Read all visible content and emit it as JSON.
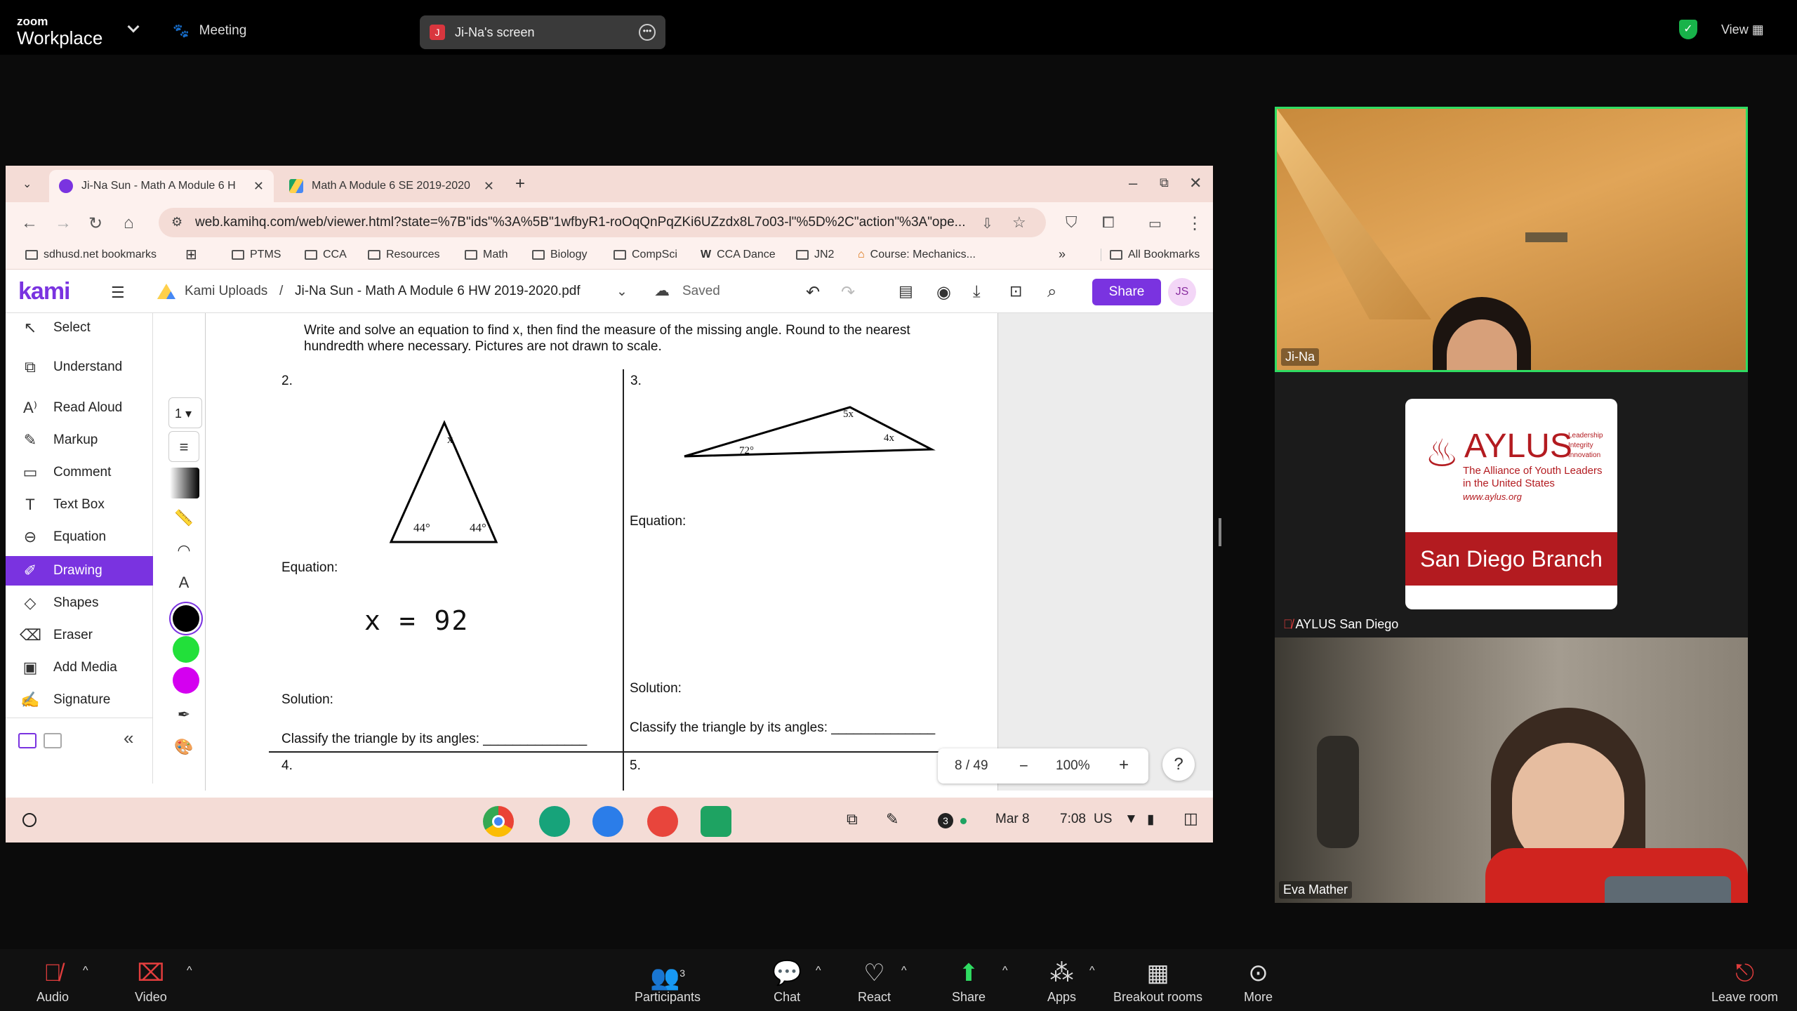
{
  "zoom": {
    "brand_small": "zoom",
    "brand_big": "Workplace",
    "meeting_label": "Meeting",
    "share_pill": {
      "initial": "J",
      "label": "Ji-Na's screen"
    },
    "view_label": "View"
  },
  "browser": {
    "tabs": [
      {
        "label": "Ji-Na Sun - Math A Module 6 H",
        "active": true
      },
      {
        "label": "Math A Module 6 SE 2019-2020",
        "active": false
      }
    ],
    "new_tab": "+",
    "url": "web.kamihq.com/web/viewer.html?state=%7B\"ids\"%3A%5B\"1wfbyR1-roOqQnPqZKi6UZzdx8L7o03-l\"%5D%2C\"action\"%3A\"ope...",
    "bookmarks": [
      "sdhusd.net bookmarks",
      "PTMS",
      "CCA",
      "Resources",
      "Math",
      "Biology",
      "CompSci",
      "CCA Dance",
      "JN2",
      "Course: Mechanics...",
      "All Bookmarks"
    ]
  },
  "kami": {
    "logo": "kami",
    "crumb_root": "Kami Uploads",
    "crumb_sep": "/",
    "doc_title": "Ji-Na Sun - Math A Module 6 HW 2019-2020.pdf",
    "saved": "Saved",
    "share": "Share",
    "avatar": "JS",
    "tools": [
      "Select",
      "Understand",
      "Read Aloud",
      "Markup",
      "Comment",
      "Text Box",
      "Equation",
      "Drawing",
      "Shapes",
      "Eraser",
      "Add Media",
      "Signature"
    ],
    "active_tool": "Drawing",
    "stroke_size": "1",
    "colors": [
      "#000000",
      "#22e03a",
      "#d400f0"
    ],
    "page_indicator": "8 / 49",
    "zoom_level": "100%",
    "help": "?"
  },
  "worksheet": {
    "instructions_line1": "Write and solve an equation to find x, then find the measure of the missing angle. Round to the nearest",
    "instructions_line2": "hundredth where necessary. Pictures are not drawn to scale.",
    "q2_num": "2.",
    "q3_num": "3.",
    "q4_num": "4.",
    "q5_num": "5.",
    "q2_angles": {
      "top": "x",
      "left": "44°",
      "right": "44°"
    },
    "q3_angles": {
      "top": "5x",
      "left": "72°",
      "right": "4x"
    },
    "equation_label": "Equation:",
    "solution_label": "Solution:",
    "classify_label": "Classify the triangle by its angles:",
    "handwriting": "x = 92"
  },
  "shelf": {
    "notification_count": "3",
    "date": "Mar 8",
    "time": "7:08",
    "locale": "US"
  },
  "participants": [
    {
      "name": "Ji-Na"
    },
    {
      "name": "AYLUS San Diego"
    },
    {
      "name": "Eva Mather"
    }
  ],
  "aylus_logo": {
    "title": "AYLUS",
    "motto": [
      "Leadership",
      "Integrity",
      "Innovation"
    ],
    "sub1": "The Alliance of Youth Leaders",
    "sub2": "in the United States",
    "site": "www.aylus.org",
    "branch": "San Diego Branch"
  },
  "toolbar": {
    "audio": "Audio",
    "video": "Video",
    "participants": "Participants",
    "participants_count": "3",
    "chat": "Chat",
    "react": "React",
    "share": "Share",
    "apps": "Apps",
    "breakout": "Breakout rooms",
    "more": "More",
    "leave": "Leave room"
  }
}
